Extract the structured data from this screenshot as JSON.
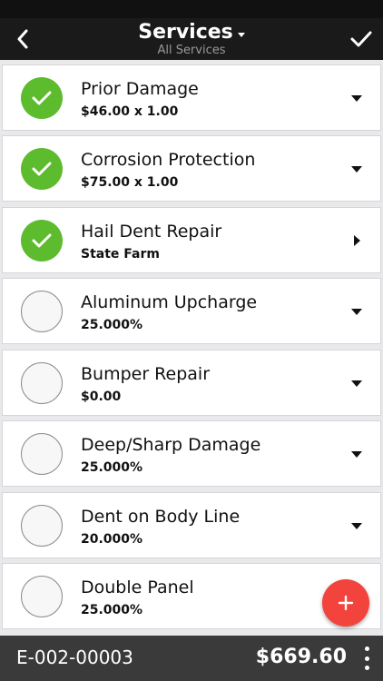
{
  "header": {
    "title": "Services",
    "subtitle": "All Services",
    "back_icon": "back-chevron-icon",
    "done_icon": "checkmark-icon"
  },
  "services": [
    {
      "name": "Prior Damage",
      "detail": "$46.00 x 1.00",
      "selected": true,
      "arrow": "down"
    },
    {
      "name": "Corrosion Protection",
      "detail": "$75.00 x 1.00",
      "selected": true,
      "arrow": "down"
    },
    {
      "name": "Hail Dent Repair",
      "detail": "State Farm",
      "selected": true,
      "arrow": "right"
    },
    {
      "name": "Aluminum Upcharge",
      "detail": "25.000%",
      "selected": false,
      "arrow": "down"
    },
    {
      "name": "Bumper Repair",
      "detail": "$0.00",
      "selected": false,
      "arrow": "down"
    },
    {
      "name": "Deep/Sharp Damage",
      "detail": "25.000%",
      "selected": false,
      "arrow": "down"
    },
    {
      "name": "Dent on Body Line",
      "detail": "20.000%",
      "selected": false,
      "arrow": "down"
    },
    {
      "name": "Double Panel",
      "detail": "25.000%",
      "selected": false,
      "arrow": "none"
    }
  ],
  "fab": {
    "icon": "plus-icon"
  },
  "footer": {
    "ref": "E-002-00003",
    "total": "$669.60",
    "menu_icon": "more-vertical-icon"
  },
  "colors": {
    "header_bg": "#1a1a1a",
    "selected_green": "#5dbb2e",
    "fab_red": "#f2433c",
    "footer_bg": "#3a3a3a"
  }
}
